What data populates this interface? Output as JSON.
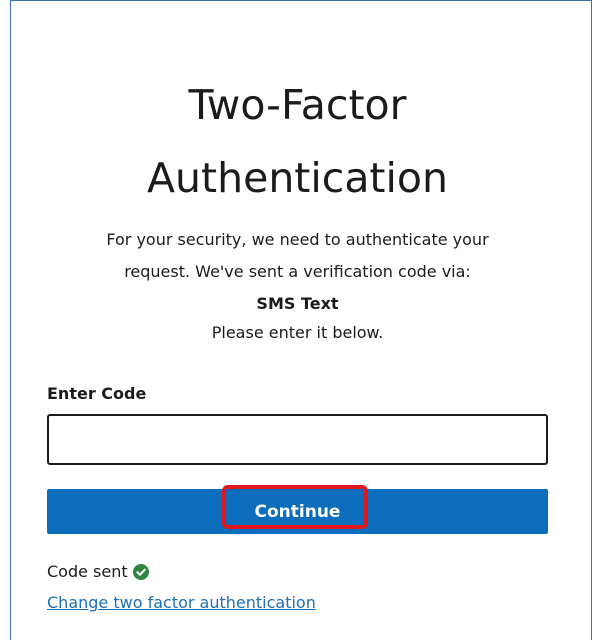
{
  "header": {
    "title_line1": "Two-Factor",
    "title_line2": "Authentication"
  },
  "description": {
    "line1": "For your security, we need to authenticate your",
    "line2": "request. We've sent a verification code via:",
    "method": "SMS Text",
    "line4": "Please enter it below."
  },
  "form": {
    "code_label": "Enter Code",
    "code_value": "",
    "continue_label": "Continue"
  },
  "status": {
    "code_sent_text": "Code sent",
    "code_sent_icon": "check-circle-icon",
    "success_color": "#2e8540"
  },
  "links": {
    "change_2fa": "Change two factor authentication"
  },
  "colors": {
    "primary_button": "#0d6dbd",
    "highlight": "#e2171e",
    "link": "#1f6fb5"
  }
}
